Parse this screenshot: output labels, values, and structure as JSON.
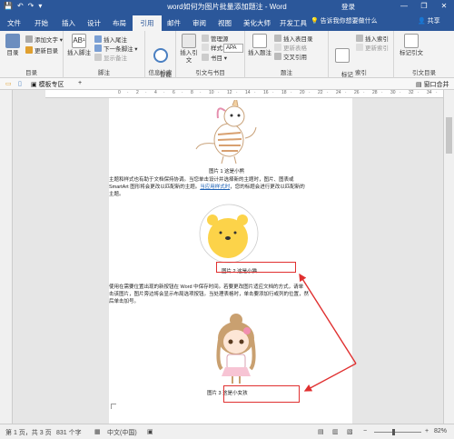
{
  "window": {
    "title": "word如何为图片批量添加题注 - Word",
    "login": "登录",
    "controls": [
      "—",
      "❐",
      "✕"
    ]
  },
  "qat": [
    "💾",
    "↶",
    "↷",
    "▾"
  ],
  "tabs": [
    "文件",
    "开始",
    "插入",
    "设计",
    "布局",
    "引用",
    "邮件",
    "审阅",
    "视图",
    "美化大师",
    "开发工具"
  ],
  "active_tab": "引用",
  "tell_me": "告诉我你想要做什么",
  "share": "共享",
  "ribbon": {
    "toc": {
      "button": "目录",
      "add_text": "添加文字",
      "update": "更新目录",
      "group": "目录"
    },
    "footnote": {
      "insert": "插入脚注",
      "insert_endnote": "插入尾注",
      "next": "下一条脚注",
      "show": "显示备注",
      "group": "脚注"
    },
    "research": {
      "smart": "智能\n查找",
      "group": "信息检索"
    },
    "citation": {
      "insert": "插入引文",
      "manage": "管理源",
      "style_label": "样式:",
      "style_value": "APA",
      "bibliography": "书目",
      "group": "引文与书目"
    },
    "caption": {
      "insert": "插入题注",
      "table_of_figures": "插入表目录",
      "update_table": "更新表格",
      "cross_ref": "交叉引用",
      "group": "题注"
    },
    "index": {
      "mark": "标记\n索引项",
      "insert": "插入索引",
      "update": "更新索引",
      "group": "索引"
    },
    "authorities": {
      "mark": "标记引文",
      "group": "引文目录"
    }
  },
  "navbar": {
    "template_tab": "模板专区",
    "plus": "+",
    "restore": "窗口合并"
  },
  "document": {
    "caption1": "图片 1 这是小熊",
    "para1": [
      "主题和样式也有助于文档保持协调。当您单击设计并选择新的主题时，图片、图表或",
      "SmartArt 图形将会更改以匹配新的主题。",
      "当应用样式时",
      "，您的标题会进行更改以匹配新的",
      "主题。"
    ],
    "caption2": "图片 2 这是小猫",
    "para2": [
      "使用在需要位置出现的新按钮在 Word 中保存时间。若要更改图片适应文档的方式，请单",
      "击该图片，图片旁边将会显示布局选项按钮。当处理表格时，单击要添加行或列的位置，然",
      "后单击加号。"
    ],
    "caption3": "图片 3 这是小女孩"
  },
  "status": {
    "page": "第 1 页，共 3 页",
    "words": "831 个字",
    "lang": "中文(中国)",
    "zoom": "82%"
  },
  "colors": {
    "word_blue": "#2b579a",
    "annotation_red": "#e03030",
    "bear_yellow": "#fcd349"
  }
}
